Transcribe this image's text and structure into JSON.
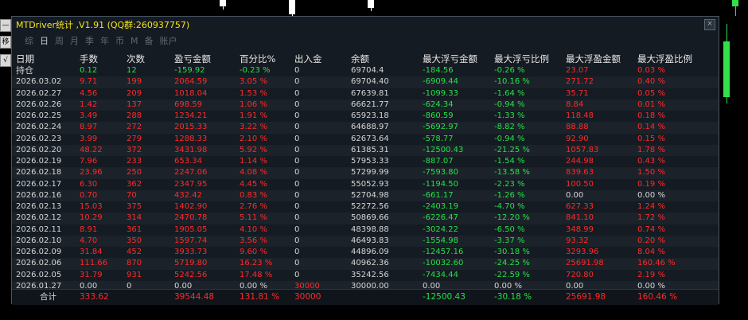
{
  "window": {
    "title": "MTDriver统计 ,V1.91 (QQ群:260937757)",
    "close_label": "×"
  },
  "left_buttons": [
    "—",
    "移",
    "√"
  ],
  "tabs": [
    {
      "label": "综",
      "active": false
    },
    {
      "label": "日",
      "active": true
    },
    {
      "label": "周",
      "active": false
    },
    {
      "label": "月",
      "active": false
    },
    {
      "label": "季",
      "active": false
    },
    {
      "label": "年",
      "active": false
    },
    {
      "label": "币",
      "active": false
    },
    {
      "label": "M",
      "active": false
    },
    {
      "label": "备",
      "active": false
    },
    {
      "label": "账户",
      "active": false
    }
  ],
  "headers": [
    "日期",
    "手数",
    "次数",
    "盈亏金额",
    "百分比%",
    "出入金",
    "余额",
    "最大浮亏金额",
    "最大浮亏比例",
    "最大浮盈金额",
    "最大浮盈比例"
  ],
  "holding": {
    "label": "持仓",
    "lots": "0.12",
    "count": "12",
    "pnl": "-159.92",
    "pct": "-0.23 %",
    "flow": "0",
    "balance": "69704.4",
    "max_loss": "-184.56",
    "max_loss_pct": "-0.26 %",
    "max_gain": "23.07",
    "max_gain_pct": "0.03 %"
  },
  "rows": [
    [
      "2026.03.02",
      "9.71",
      "199",
      "2064.59",
      "3.05 %",
      "0",
      "69704.40",
      "-6909.44",
      "-10.16 %",
      "271.72",
      "0.40 %"
    ],
    [
      "2026.02.27",
      "4.56",
      "209",
      "1018.04",
      "1.53 %",
      "0",
      "67639.81",
      "-1099.33",
      "-1.64 %",
      "35.71",
      "0.05 %"
    ],
    [
      "2026.02.26",
      "1.42",
      "137",
      "698.59",
      "1.06 %",
      "0",
      "66621.77",
      "-624.34",
      "-0.94 %",
      "8.84",
      "0.01 %"
    ],
    [
      "2026.02.25",
      "3.49",
      "288",
      "1234.21",
      "1.91 %",
      "0",
      "65923.18",
      "-860.59",
      "-1.33 %",
      "118.48",
      "0.18 %"
    ],
    [
      "2026.02.24",
      "8.97",
      "272",
      "2015.33",
      "3.22 %",
      "0",
      "64688.97",
      "-5692.97",
      "-8.82 %",
      "88.88",
      "0.14 %"
    ],
    [
      "2026.02.23",
      "3.99",
      "279",
      "1288.33",
      "2.10 %",
      "0",
      "62673.64",
      "-578.77",
      "-0.94 %",
      "92.90",
      "0.15 %"
    ],
    [
      "2026.02.20",
      "48.22",
      "372",
      "3431.98",
      "5.92 %",
      "0",
      "61385.31",
      "-12500.43",
      "-21.25 %",
      "1057.83",
      "1.78 %"
    ],
    [
      "2026.02.19",
      "7.96",
      "233",
      "653.34",
      "1.14 %",
      "0",
      "57953.33",
      "-887.07",
      "-1.54 %",
      "244.98",
      "0.43 %"
    ],
    [
      "2026.02.18",
      "23.96",
      "250",
      "2247.06",
      "4.08 %",
      "0",
      "57299.99",
      "-7593.80",
      "-13.58 %",
      "839.63",
      "1.50 %"
    ],
    [
      "2026.02.17",
      "6.30",
      "362",
      "2347.95",
      "4.45 %",
      "0",
      "55052.93",
      "-1194.50",
      "-2.23 %",
      "100.50",
      "0.19 %"
    ],
    [
      "2026.02.16",
      "0.70",
      "70",
      "432.42",
      "0.83 %",
      "0",
      "52704.98",
      "-661.17",
      "-1.26 %",
      "0.00",
      "0.00 %"
    ],
    [
      "2026.02.13",
      "15.03",
      "375",
      "1402.90",
      "2.76 %",
      "0",
      "52272.56",
      "-2403.19",
      "-4.70 %",
      "627.33",
      "1.24 %"
    ],
    [
      "2026.02.12",
      "10.29",
      "314",
      "2470.78",
      "5.11 %",
      "0",
      "50869.66",
      "-6226.47",
      "-12.20 %",
      "841.10",
      "1.72 %"
    ],
    [
      "2026.02.11",
      "8.91",
      "361",
      "1905.05",
      "4.10 %",
      "0",
      "48398.88",
      "-3024.22",
      "-6.50 %",
      "348.99",
      "0.74 %"
    ],
    [
      "2026.02.10",
      "4.70",
      "350",
      "1597.74",
      "3.56 %",
      "0",
      "46493.83",
      "-1554.98",
      "-3.37 %",
      "93.32",
      "0.20 %"
    ],
    [
      "2026.02.09",
      "31.84",
      "452",
      "3933.73",
      "9.60 %",
      "0",
      "44896.09",
      "-12457.16",
      "-30.18 %",
      "3293.96",
      "8.04 %"
    ],
    [
      "2026.02.06",
      "111.66",
      "870",
      "5719.80",
      "16.23 %",
      "0",
      "40962.36",
      "-10032.60",
      "-24.25 %",
      "25691.98",
      "160.46 %"
    ],
    [
      "2026.02.05",
      "31.79",
      "931",
      "5242.56",
      "17.48 %",
      "0",
      "35242.56",
      "-7434.44",
      "-22.59 %",
      "720.80",
      "2.19 %"
    ],
    [
      "2026.01.27",
      "0.00",
      "0",
      "0.00",
      "0.00 %",
      "30000",
      "30000.00",
      "0.00",
      "0.00 %",
      "0.00",
      "0.00 %"
    ]
  ],
  "total": {
    "label": "合计",
    "lots": "333.62",
    "count": "",
    "pnl": "39544.48",
    "pct": "131.81 %",
    "flow": "30000",
    "balance": "",
    "max_loss": "-12500.43",
    "max_loss_pct": "-30.18 %",
    "max_gain": "25691.98",
    "max_gain_pct": "160.46 %"
  },
  "colors": {
    "profit": "#ff2a2a",
    "loss": "#26e04a",
    "neutral": "#d6d6d6",
    "title": "#f5e51a"
  }
}
